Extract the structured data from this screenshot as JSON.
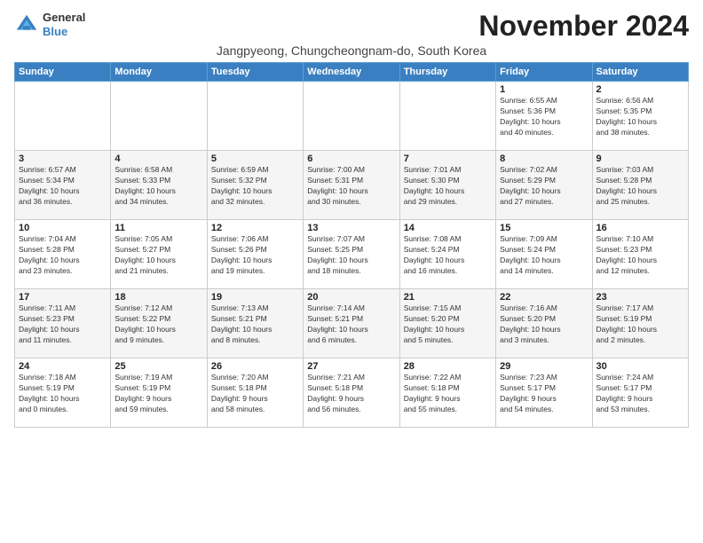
{
  "header": {
    "logo_line1": "General",
    "logo_line2": "Blue",
    "title": "November 2024",
    "subtitle": "Jangpyeong, Chungcheongnam-do, South Korea"
  },
  "days_of_week": [
    "Sunday",
    "Monday",
    "Tuesday",
    "Wednesday",
    "Thursday",
    "Friday",
    "Saturday"
  ],
  "weeks": [
    [
      {
        "day": "",
        "info": ""
      },
      {
        "day": "",
        "info": ""
      },
      {
        "day": "",
        "info": ""
      },
      {
        "day": "",
        "info": ""
      },
      {
        "day": "",
        "info": ""
      },
      {
        "day": "1",
        "info": "Sunrise: 6:55 AM\nSunset: 5:36 PM\nDaylight: 10 hours\nand 40 minutes."
      },
      {
        "day": "2",
        "info": "Sunrise: 6:56 AM\nSunset: 5:35 PM\nDaylight: 10 hours\nand 38 minutes."
      }
    ],
    [
      {
        "day": "3",
        "info": "Sunrise: 6:57 AM\nSunset: 5:34 PM\nDaylight: 10 hours\nand 36 minutes."
      },
      {
        "day": "4",
        "info": "Sunrise: 6:58 AM\nSunset: 5:33 PM\nDaylight: 10 hours\nand 34 minutes."
      },
      {
        "day": "5",
        "info": "Sunrise: 6:59 AM\nSunset: 5:32 PM\nDaylight: 10 hours\nand 32 minutes."
      },
      {
        "day": "6",
        "info": "Sunrise: 7:00 AM\nSunset: 5:31 PM\nDaylight: 10 hours\nand 30 minutes."
      },
      {
        "day": "7",
        "info": "Sunrise: 7:01 AM\nSunset: 5:30 PM\nDaylight: 10 hours\nand 29 minutes."
      },
      {
        "day": "8",
        "info": "Sunrise: 7:02 AM\nSunset: 5:29 PM\nDaylight: 10 hours\nand 27 minutes."
      },
      {
        "day": "9",
        "info": "Sunrise: 7:03 AM\nSunset: 5:28 PM\nDaylight: 10 hours\nand 25 minutes."
      }
    ],
    [
      {
        "day": "10",
        "info": "Sunrise: 7:04 AM\nSunset: 5:28 PM\nDaylight: 10 hours\nand 23 minutes."
      },
      {
        "day": "11",
        "info": "Sunrise: 7:05 AM\nSunset: 5:27 PM\nDaylight: 10 hours\nand 21 minutes."
      },
      {
        "day": "12",
        "info": "Sunrise: 7:06 AM\nSunset: 5:26 PM\nDaylight: 10 hours\nand 19 minutes."
      },
      {
        "day": "13",
        "info": "Sunrise: 7:07 AM\nSunset: 5:25 PM\nDaylight: 10 hours\nand 18 minutes."
      },
      {
        "day": "14",
        "info": "Sunrise: 7:08 AM\nSunset: 5:24 PM\nDaylight: 10 hours\nand 16 minutes."
      },
      {
        "day": "15",
        "info": "Sunrise: 7:09 AM\nSunset: 5:24 PM\nDaylight: 10 hours\nand 14 minutes."
      },
      {
        "day": "16",
        "info": "Sunrise: 7:10 AM\nSunset: 5:23 PM\nDaylight: 10 hours\nand 12 minutes."
      }
    ],
    [
      {
        "day": "17",
        "info": "Sunrise: 7:11 AM\nSunset: 5:23 PM\nDaylight: 10 hours\nand 11 minutes."
      },
      {
        "day": "18",
        "info": "Sunrise: 7:12 AM\nSunset: 5:22 PM\nDaylight: 10 hours\nand 9 minutes."
      },
      {
        "day": "19",
        "info": "Sunrise: 7:13 AM\nSunset: 5:21 PM\nDaylight: 10 hours\nand 8 minutes."
      },
      {
        "day": "20",
        "info": "Sunrise: 7:14 AM\nSunset: 5:21 PM\nDaylight: 10 hours\nand 6 minutes."
      },
      {
        "day": "21",
        "info": "Sunrise: 7:15 AM\nSunset: 5:20 PM\nDaylight: 10 hours\nand 5 minutes."
      },
      {
        "day": "22",
        "info": "Sunrise: 7:16 AM\nSunset: 5:20 PM\nDaylight: 10 hours\nand 3 minutes."
      },
      {
        "day": "23",
        "info": "Sunrise: 7:17 AM\nSunset: 5:19 PM\nDaylight: 10 hours\nand 2 minutes."
      }
    ],
    [
      {
        "day": "24",
        "info": "Sunrise: 7:18 AM\nSunset: 5:19 PM\nDaylight: 10 hours\nand 0 minutes."
      },
      {
        "day": "25",
        "info": "Sunrise: 7:19 AM\nSunset: 5:19 PM\nDaylight: 9 hours\nand 59 minutes."
      },
      {
        "day": "26",
        "info": "Sunrise: 7:20 AM\nSunset: 5:18 PM\nDaylight: 9 hours\nand 58 minutes."
      },
      {
        "day": "27",
        "info": "Sunrise: 7:21 AM\nSunset: 5:18 PM\nDaylight: 9 hours\nand 56 minutes."
      },
      {
        "day": "28",
        "info": "Sunrise: 7:22 AM\nSunset: 5:18 PM\nDaylight: 9 hours\nand 55 minutes."
      },
      {
        "day": "29",
        "info": "Sunrise: 7:23 AM\nSunset: 5:17 PM\nDaylight: 9 hours\nand 54 minutes."
      },
      {
        "day": "30",
        "info": "Sunrise: 7:24 AM\nSunset: 5:17 PM\nDaylight: 9 hours\nand 53 minutes."
      }
    ]
  ]
}
